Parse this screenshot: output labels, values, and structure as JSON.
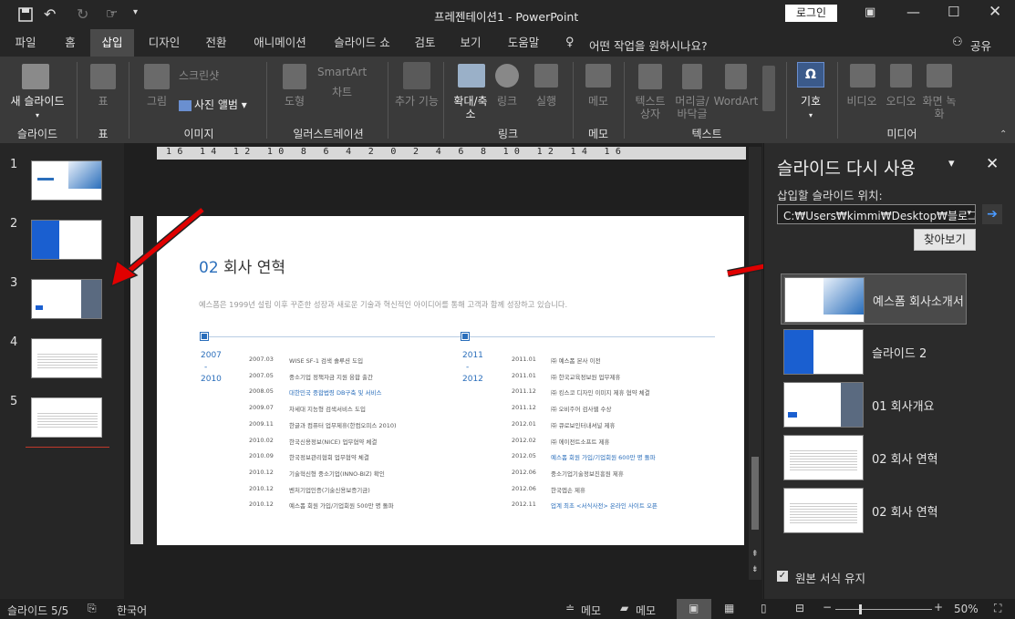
{
  "window": {
    "title": "프레젠테이션1  -  PowerPoint",
    "login": "로그인"
  },
  "tabs": [
    "파일",
    "홈",
    "삽입",
    "디자인",
    "전환",
    "애니메이션",
    "슬라이드 쇼",
    "검토",
    "보기",
    "도움말"
  ],
  "tell_me": "어떤 작업을 원하시나요?",
  "share": "공유",
  "ribbon": {
    "new_slide": "새 슬라이드",
    "table": "표",
    "picture": "그림",
    "screenshot": "스크린샷",
    "photo_album": "사진 앨범",
    "shapes": "도형",
    "smartart": "SmartArt",
    "chart": "차트",
    "addins": "추가 기능",
    "zoom": "확대/축소",
    "link": "링크",
    "action": "실행",
    "comment": "메모",
    "textbox": "텍스트 상자",
    "header_footer": "머리글/바닥글",
    "wordart": "WordArt",
    "symbols": "기호",
    "video": "비디오",
    "audio": "오디오",
    "screen_rec": "화면 녹화",
    "groups": [
      "슬라이드",
      "표",
      "이미지",
      "일러스트레이션",
      "링크",
      "메모",
      "텍스트",
      "미디어"
    ]
  },
  "thumbs": [
    "1",
    "2",
    "3",
    "4",
    "5"
  ],
  "ruler_h": "16 14 12 10 8 6 4 2 0 2 4 6 8 10 12 14 16",
  "slide": {
    "num": "02",
    "title": "회사 연혁",
    "desc": "예스폼은 1999년 설립 이후 꾸준한 성장과 새로운 기술과 혁신적인 아이디어를 통해 고객과 함께 성장하고 있습니다.",
    "period1": [
      "2007",
      "-",
      "2010"
    ],
    "period2": [
      "2011",
      "-",
      "2012"
    ],
    "col1": [
      {
        "d": "2007.03",
        "t": "WISE SF-1 검색 솔루션 도입"
      },
      {
        "d": "2007.05",
        "t": "중소기업 정책자금 지원 융합 출간"
      },
      {
        "d": "2008.05",
        "t": "대한민국 중합법령 DB구축 및 서비스"
      },
      {
        "d": "2009.07",
        "t": "차세대 지능형 검색서비스 도입"
      },
      {
        "d": "2009.11",
        "t": "한글과 컴퓨터 업무제휴(한컴오피스 2010)"
      },
      {
        "d": "2010.02",
        "t": "한국신용정보(NICE) 업무협약 체결"
      },
      {
        "d": "2010.09",
        "t": "한국정보관리협회 업무협약 체결"
      },
      {
        "d": "2010.12",
        "t": "기술혁신형 중소기업(INNO-BIZ) 확인"
      },
      {
        "d": "2010.12",
        "t": "벤처기업인증(기술신용보증기금)"
      },
      {
        "d": "2010.12",
        "t": "예스폼 회원 가입/기업회원 500만 명 돌파"
      }
    ],
    "col2": [
      {
        "d": "2011.01",
        "t": "㈜ 예스폼 본사 이전"
      },
      {
        "d": "2011.01",
        "t": "㈜ 한국교육정보원 업무제휴"
      },
      {
        "d": "2011.12",
        "t": "㈜ 킹스코 디자인 이미지 제휴 협약 체결"
      },
      {
        "d": "2011.12",
        "t": "㈜ 오비주어 검사웹 수상"
      },
      {
        "d": "2012.01",
        "t": "㈜ 큐로보인터내셔널 제휴"
      },
      {
        "d": "2012.02",
        "t": "㈜ 에이전트소프트 제휴"
      },
      {
        "d": "2012.05",
        "t": "예스폼 회원 가입/기업회원 600만 명 돌파"
      },
      {
        "d": "2012.06",
        "t": "중소기업기술정보진흥원 제휴"
      },
      {
        "d": "2012.06",
        "t": "한국엡손 제휴"
      },
      {
        "d": "2012.11",
        "t": "업계 최초 <서식사전> 온라인 사이트 오픈"
      }
    ]
  },
  "pane": {
    "title": "슬라이드 다시 사용",
    "insert_label": "삽입할 슬라이드 위치:",
    "path": "C:₩Users₩kimmi₩Desktop₩블로그",
    "browse": "찾아보기",
    "items": [
      "예스폼 회사소개서",
      "슬라이드 2",
      "01 회사개요",
      "02 회사 연혁",
      "02 회사 연혁"
    ],
    "keep_format": "원본 서식 유지"
  },
  "status": {
    "slide": "슬라이드 5/5",
    "lang": "한국어",
    "notes": "메모",
    "comments": "메모",
    "zoom": "50%"
  },
  "colors": {
    "accent": "#2a6ebb",
    "arrow": "#e00000",
    "tab_active": "#4a4a4a"
  }
}
